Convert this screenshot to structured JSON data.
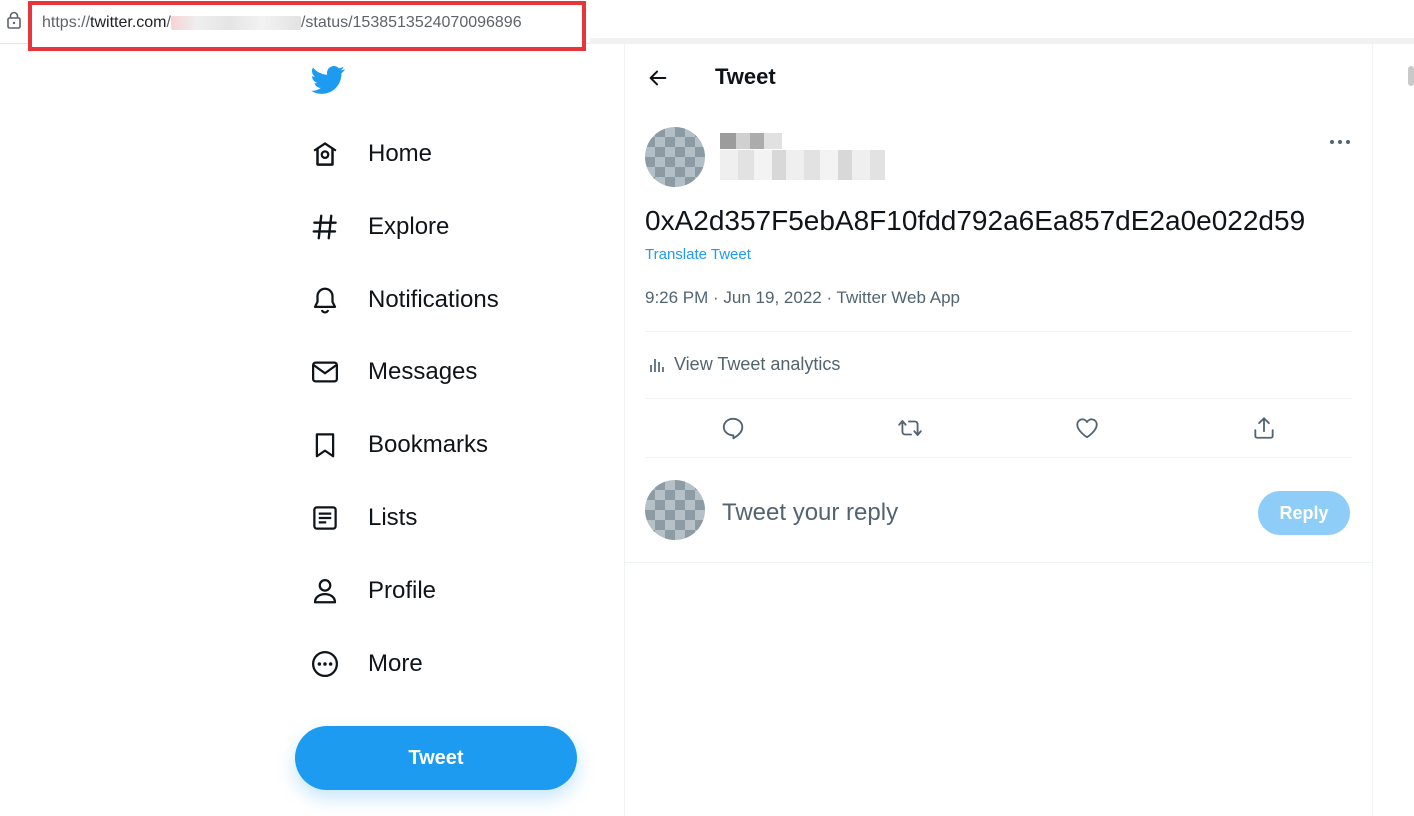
{
  "browser": {
    "url_prefix": "https://",
    "url_host": "twitter.com",
    "url_sep": "/",
    "url_path": "/status/1538513524070096896"
  },
  "sidebar": {
    "logo": "twitter-bird-icon",
    "items": [
      {
        "label": "Home",
        "icon": "home-icon"
      },
      {
        "label": "Explore",
        "icon": "hashtag-icon"
      },
      {
        "label": "Notifications",
        "icon": "bell-icon"
      },
      {
        "label": "Messages",
        "icon": "envelope-icon"
      },
      {
        "label": "Bookmarks",
        "icon": "bookmark-icon"
      },
      {
        "label": "Lists",
        "icon": "list-icon"
      },
      {
        "label": "Profile",
        "icon": "person-icon"
      },
      {
        "label": "More",
        "icon": "more-circle-icon"
      }
    ],
    "tweet_button": "Tweet"
  },
  "main": {
    "header_title": "Tweet",
    "tweet": {
      "text": "0xA2d357F5ebA8F10fdd792a6Ea857dE2a0e022d59",
      "translate_label": "Translate Tweet",
      "meta": "9:26 PM · Jun 19, 2022 · Twitter Web App",
      "analytics_label": "View Tweet analytics"
    },
    "reply": {
      "placeholder": "Tweet your reply",
      "button": "Reply"
    }
  },
  "colors": {
    "accent": "#1d9bf0",
    "reply_disabled": "#8ecdf8",
    "highlight_box": "#e8353b"
  }
}
